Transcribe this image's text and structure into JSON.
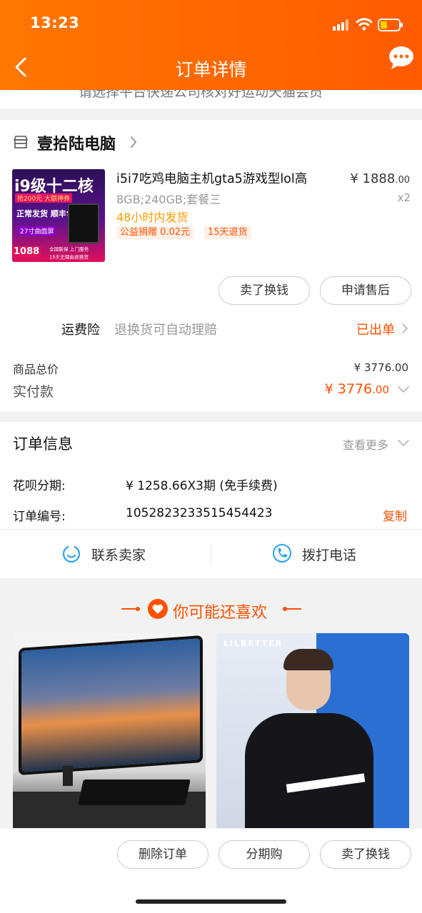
{
  "status_bar": {
    "time": "13:23"
  },
  "nav": {
    "title": "订单详情"
  },
  "notice": {
    "text": "请选择平台快递公司核对好运动天猫会员"
  },
  "shop": {
    "name": "壹拾陆电脑"
  },
  "product": {
    "title": "i5i7吃鸡电脑主机gta5游戏型lol高",
    "spec": "8GB;240GB;套餐三",
    "shipping": "48小时内发货",
    "tags": [
      "公益捐赠 0.02元",
      "15天退货"
    ],
    "price_int": "¥ 1888",
    "price_dec": ".00",
    "quantity": "x2",
    "thumb": {
      "line1": "i9级十二核",
      "line2": "抢200元 大额神券",
      "line3": "正常发货  顺丰包邮",
      "line4": "27寸曲面屏",
      "price": "1088",
      "line5": "全国联保 上门服务",
      "line6": "15天无理由退换货"
    }
  },
  "actions": {
    "sell": "卖了换钱",
    "after_sale": "申请售后"
  },
  "insurance": {
    "label": "运费险",
    "desc": "退换货可自动理赔",
    "status": "已出单"
  },
  "totals": {
    "goods_label": "商品总价",
    "goods_value": "¥ 3776.00",
    "paid_label": "实付款",
    "paid_int": "¥ 3776",
    "paid_dec": ".00"
  },
  "order_info": {
    "title": "订单信息",
    "more": "查看更多",
    "rows": [
      {
        "label": "花呗分期:",
        "value": "¥ 1258.66X3期 (免手续费)"
      },
      {
        "label": "订单编号:",
        "value": "1052823233515454423"
      }
    ],
    "copy": "复制"
  },
  "contact": {
    "seller": "联系卖家",
    "phone": "拨打电话"
  },
  "recommend": {
    "title": "你可能还喜欢",
    "brand": "LILBETTER"
  },
  "bottom_bar": {
    "delete": "删除订单",
    "installment": "分期购",
    "sell": "卖了换钱"
  },
  "colors": {
    "accent": "#ff5000",
    "header": "#ff6a00"
  }
}
